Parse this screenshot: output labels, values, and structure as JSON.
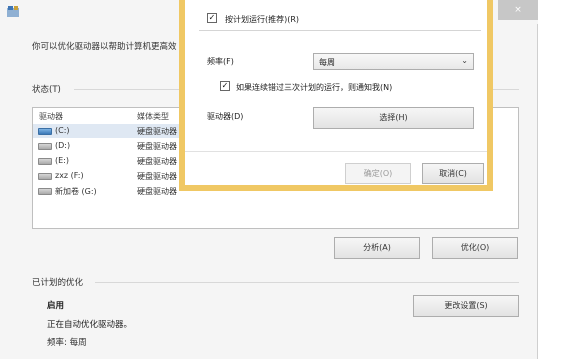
{
  "window": {
    "close_label": "×",
    "description": "你可以优化驱动器以帮助计算机更高效",
    "status_label": "状态(T)",
    "columns": {
      "drive": "驱动器",
      "media": "媒体类型"
    },
    "drives": [
      {
        "name": "(C:)",
        "media": "硬盘驱动器",
        "icon": "windows-drive-icon",
        "selected": true
      },
      {
        "name": "(D:)",
        "media": "硬盘驱动器",
        "icon": "hard-drive-icon",
        "selected": false
      },
      {
        "name": "(E:)",
        "media": "硬盘驱动器",
        "icon": "hard-drive-icon",
        "selected": false
      },
      {
        "name": "zxz (F:)",
        "media": "硬盘驱动器",
        "icon": "hard-drive-icon",
        "selected": false
      },
      {
        "name": "新加卷 (G:)",
        "media": "硬盘驱动器",
        "icon": "hard-drive-icon",
        "selected": false
      }
    ],
    "analyze_button": "分析(A)",
    "optimize_button": "优化(O)",
    "scheduled_heading": "已计划的优化",
    "enabled": "启用",
    "auto_optimizing": "正在自动优化驱动器。",
    "frequency_status": "频率: 每周",
    "change_settings_button": "更改设置(S)"
  },
  "dialog": {
    "run_on_schedule": "按计划运行(推荐)(R)",
    "run_on_schedule_checked": true,
    "frequency_label": "频率(F)",
    "frequency_value": "每周",
    "notify_missed": "如果连续错过三次计划的运行，则通知我(N)",
    "notify_missed_checked": true,
    "drives_label": "驱动器(D)",
    "choose_button": "选择(H)",
    "ok_button": "确定(O)",
    "cancel_button": "取消(C)"
  }
}
